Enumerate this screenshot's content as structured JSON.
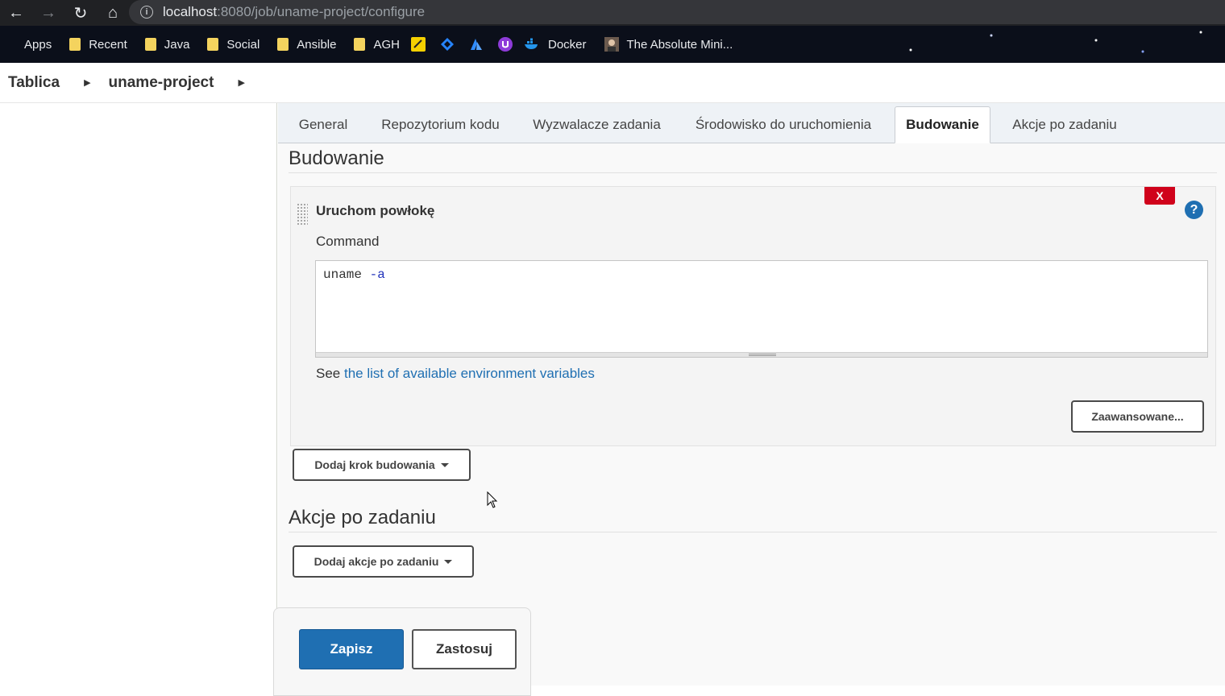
{
  "browser": {
    "url_host": "localhost",
    "url_rest": ":8080/job/uname-project/configure",
    "bookmarks": [
      {
        "label": "Apps",
        "icon": "apps-grid-icon"
      },
      {
        "label": "Recent",
        "icon": "folder-icon"
      },
      {
        "label": "Java",
        "icon": "folder-icon"
      },
      {
        "label": "Social",
        "icon": "folder-icon"
      },
      {
        "label": "Ansible",
        "icon": "folder-icon"
      },
      {
        "label": "AGH",
        "icon": "folder-icon"
      },
      {
        "label": "",
        "icon": "yellow-app-icon"
      },
      {
        "label": "",
        "icon": "jira-icon"
      },
      {
        "label": "",
        "icon": "azure-icon"
      },
      {
        "label": "",
        "icon": "purple-app-icon"
      },
      {
        "label": "Docker",
        "icon": "docker-icon"
      },
      {
        "label": "The Absolute Mini...",
        "icon": "avatar-icon"
      }
    ]
  },
  "breadcrumb": {
    "items": [
      "Tablica",
      "uname-project"
    ]
  },
  "tabs": [
    "General",
    "Repozytorium kodu",
    "Wyzwalacze zadania",
    "Środowisko do uruchomienia",
    "Budowanie",
    "Akcje po zadaniu"
  ],
  "active_tab": "Budowanie",
  "build": {
    "section_title": "Budowanie",
    "step_title": "Uruchom powłokę",
    "close_label": "X",
    "help_label": "?",
    "command_label": "Command",
    "command_word": "uname",
    "command_flag": "-a",
    "env_prefix": "See",
    "env_link": "the list of available environment variables",
    "advanced_label": "Zaawansowane...",
    "add_step_label": "Dodaj krok budowania"
  },
  "post": {
    "section_title": "Akcje po zadaniu",
    "add_action_label": "Dodaj akcje po zadaniu"
  },
  "footer": {
    "save_label": "Zapisz",
    "apply_label": "Zastosuj"
  },
  "colors": {
    "primary": "#1f6fb2",
    "danger": "#d0021b"
  }
}
